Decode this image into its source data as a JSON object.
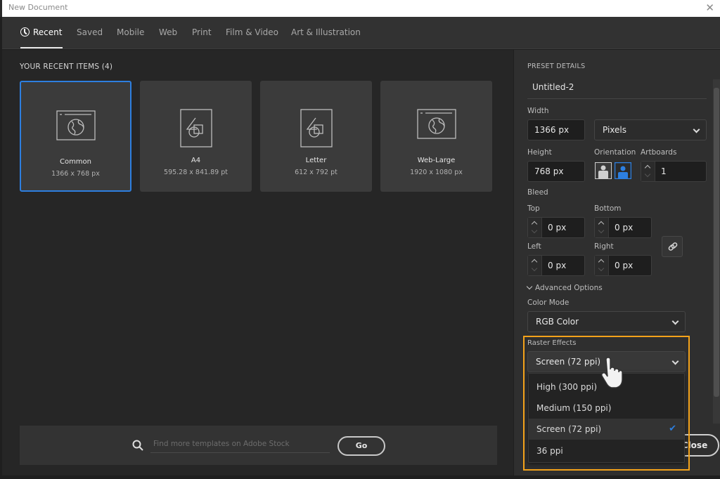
{
  "window": {
    "title": "New Document",
    "close_icon": "close-icon"
  },
  "tabs": [
    {
      "label": "Recent",
      "icon": "clock-icon",
      "active": true
    },
    {
      "label": "Saved"
    },
    {
      "label": "Mobile"
    },
    {
      "label": "Web"
    },
    {
      "label": "Print"
    },
    {
      "label": "Film & Video"
    },
    {
      "label": "Art & Illustration"
    }
  ],
  "recent": {
    "title": "YOUR RECENT ITEMS  (4)",
    "items": [
      {
        "name": "Common",
        "dims": "1366 x 768 px",
        "icon": "web-globe-icon",
        "selected": true
      },
      {
        "name": "A4",
        "dims": "595.28 x 841.89 pt",
        "icon": "print-shapes-icon"
      },
      {
        "name": "Letter",
        "dims": "612 x 792 pt",
        "icon": "print-shapes-icon"
      },
      {
        "name": "Web-Large",
        "dims": "1920 x 1080 px",
        "icon": "web-globe-icon"
      }
    ]
  },
  "stock": {
    "placeholder": "Find more templates on Adobe Stock",
    "go_label": "Go"
  },
  "preset": {
    "title": "PRESET DETAILS",
    "name": "Untitled-2",
    "width_label": "Width",
    "width_value": "1366 px",
    "units": "Pixels",
    "height_label": "Height",
    "height_value": "768 px",
    "orientation_label": "Orientation",
    "orientation_selected": "landscape",
    "artboards_label": "Artboards",
    "artboards_value": "1",
    "bleed_label": "Bleed",
    "bleed": {
      "top_label": "Top",
      "top": "0 px",
      "bottom_label": "Bottom",
      "bottom": "0 px",
      "left_label": "Left",
      "left": "0 px",
      "right_label": "Right",
      "right": "0 px"
    },
    "advanced_label": "Advanced Options",
    "color_mode_label": "Color Mode",
    "color_mode": "RGB Color",
    "raster_label": "Raster Effects",
    "raster_value": "Screen (72 ppi)",
    "raster_options": [
      {
        "label": "High (300 ppi)"
      },
      {
        "label": "Medium (150 ppi)"
      },
      {
        "label": "Screen (72 ppi)",
        "checked": true
      },
      {
        "label": "36 ppi"
      }
    ],
    "close_label": "Close"
  },
  "colors": {
    "accent": "#2d7fe0",
    "highlight": "#f3a21a"
  }
}
